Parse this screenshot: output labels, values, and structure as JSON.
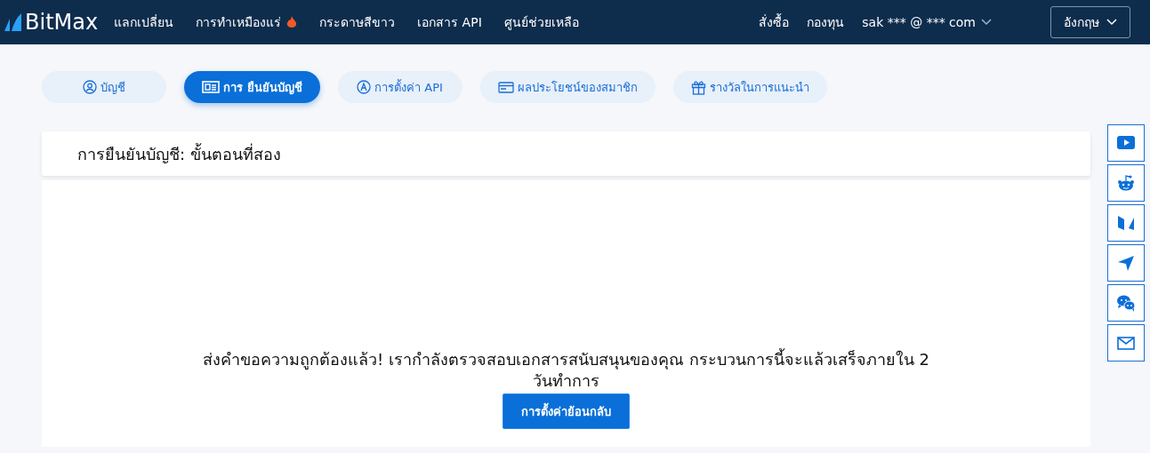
{
  "header": {
    "logo": "BitMax",
    "nav": [
      {
        "label": "แลกเปลี่ยน",
        "hot": false
      },
      {
        "label": "การทำเหมืองแร่",
        "hot": true
      },
      {
        "label": "กระดาษสีขาว",
        "hot": false
      },
      {
        "label": "เอกสาร API",
        "hot": false
      },
      {
        "label": "ศูนย์ช่วยเหลือ",
        "hot": false
      }
    ],
    "right": [
      "สั่งซื้อ",
      "กองทุน"
    ],
    "account": "sak *** @ *** com",
    "language": "อังกฤษ"
  },
  "tabs": [
    {
      "label": "บัญชี",
      "kind": "user",
      "selected": false
    },
    {
      "label": "การ ยืนยันบัญชี",
      "kind": "idcard",
      "selected": true
    },
    {
      "label": "การตั้งค่า API",
      "kind": "letter",
      "selected": false
    },
    {
      "label": "ผลประโยชน์ของสมาชิก",
      "kind": "card",
      "selected": false
    },
    {
      "label": "รางวัลในการแนะนำ",
      "kind": "gift",
      "selected": false
    }
  ],
  "card": {
    "title": "การยืนยันบัญชี: ขั้นตอนที่สอง",
    "message": "ส่งคำขอความถูกต้องแล้ว! เรากำลังตรวจสอบเอกสารสนับสนุนของคุณ กระบวนการนี้จะแล้วเสร็จภายใน 2 วันทำการ",
    "button": "การตั้งค่าย้อนกลับ"
  },
  "social": [
    {
      "kind": "video"
    },
    {
      "kind": "robot"
    },
    {
      "kind": "medium"
    },
    {
      "kind": "plane"
    },
    {
      "kind": "chat"
    },
    {
      "kind": "mail"
    }
  ]
}
